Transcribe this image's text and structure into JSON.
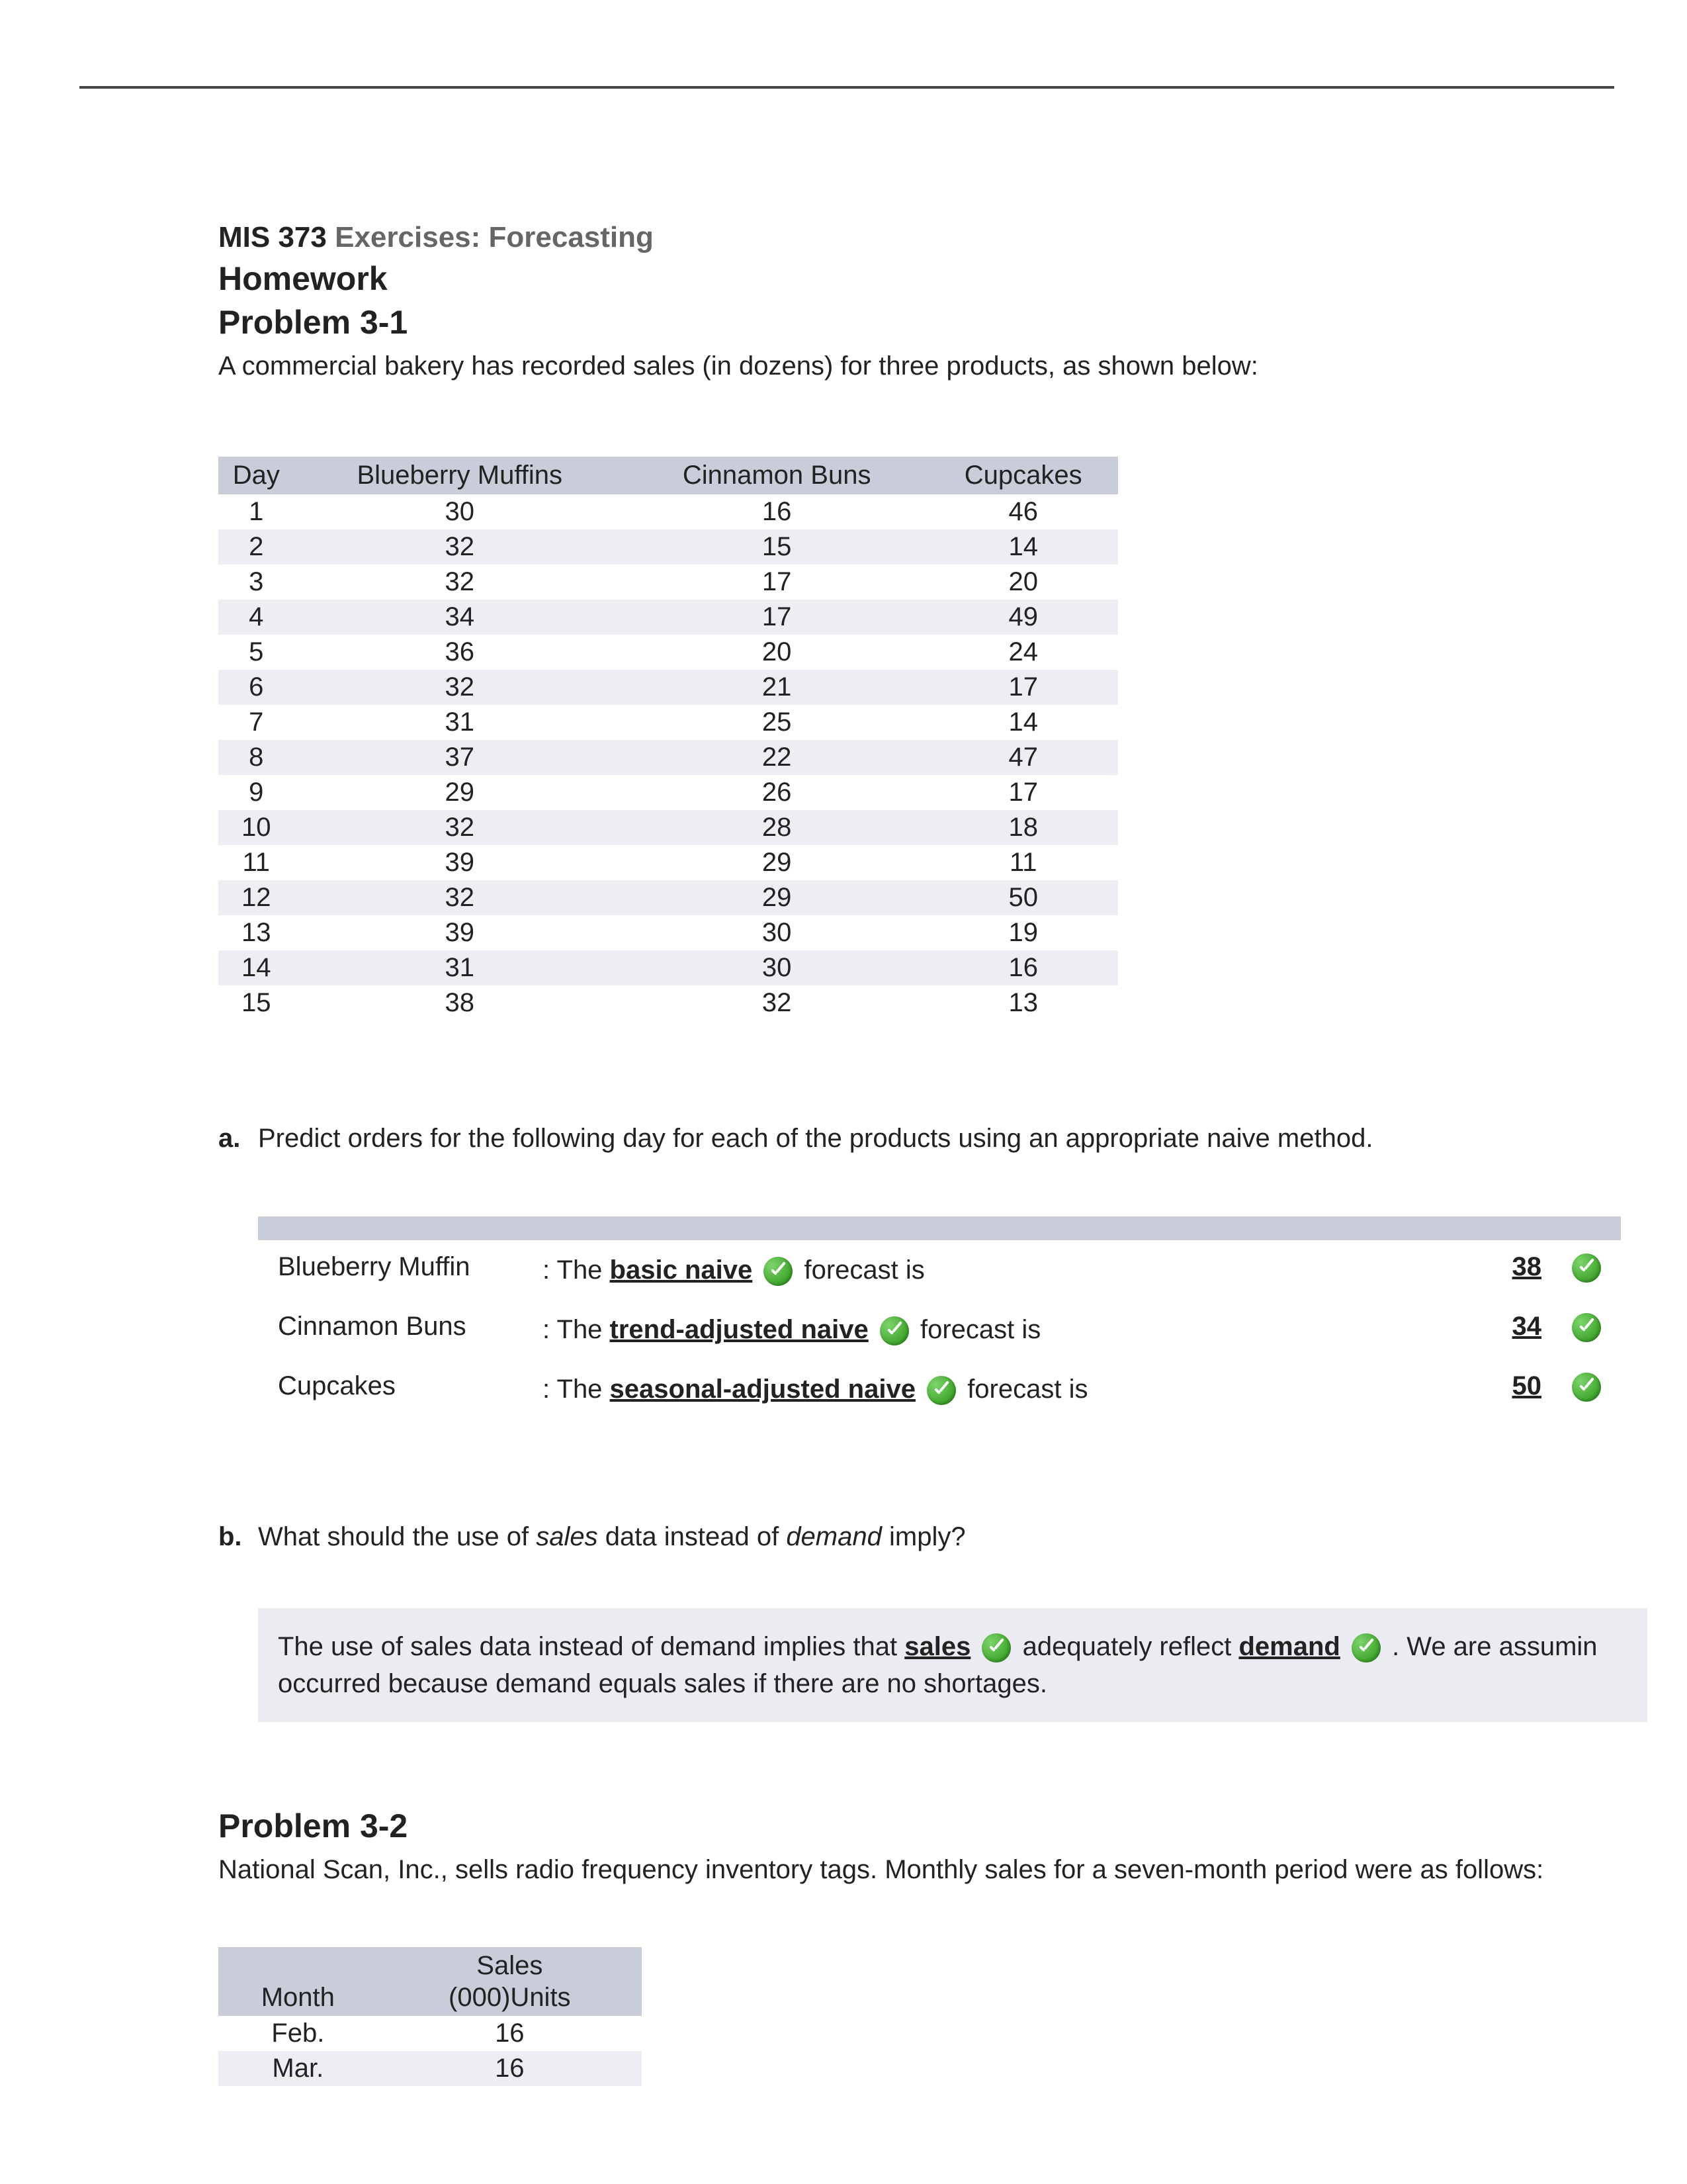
{
  "course": {
    "code": "MIS 373",
    "subtitle": "Exercises: Forecasting"
  },
  "hw_label": "Homework",
  "p1": {
    "title": "Problem 3-1",
    "intro": "A commercial bakery has recorded sales (in dozens) for three products, as shown below:",
    "table": {
      "headers": [
        "Day",
        "Blueberry Muffins",
        "Cinnamon Buns",
        "Cupcakes"
      ],
      "rows": [
        [
          "1",
          "30",
          "16",
          "46"
        ],
        [
          "2",
          "32",
          "15",
          "14"
        ],
        [
          "3",
          "32",
          "17",
          "20"
        ],
        [
          "4",
          "34",
          "17",
          "49"
        ],
        [
          "5",
          "36",
          "20",
          "24"
        ],
        [
          "6",
          "32",
          "21",
          "17"
        ],
        [
          "7",
          "31",
          "25",
          "14"
        ],
        [
          "8",
          "37",
          "22",
          "47"
        ],
        [
          "9",
          "29",
          "26",
          "17"
        ],
        [
          "10",
          "32",
          "28",
          "18"
        ],
        [
          "11",
          "39",
          "29",
          "11"
        ],
        [
          "12",
          "32",
          "29",
          "50"
        ],
        [
          "13",
          "39",
          "30",
          "19"
        ],
        [
          "14",
          "31",
          "30",
          "16"
        ],
        [
          "15",
          "38",
          "32",
          "13"
        ]
      ]
    },
    "a": {
      "label": "a.",
      "q": "Predict orders for the following day for each of the products using an appropriate naive method.",
      "rows": [
        {
          "product": "Blueberry Muffin",
          "prefix": ": The ",
          "method": "basic naive",
          "tail": " forecast is",
          "value": "38"
        },
        {
          "product": "Cinnamon Buns",
          "prefix": ": The ",
          "method": "trend-adjusted naive",
          "tail": " forecast is",
          "value": "34"
        },
        {
          "product": "Cupcakes",
          "prefix": ": The ",
          "method": "seasonal-adjusted naive",
          "tail": " forecast is",
          "value": "50"
        }
      ]
    },
    "b": {
      "label": "b.",
      "q_pre": "What should the use of ",
      "q_em1": "sales",
      "q_mid": " data instead of ",
      "q_em2": "demand",
      "q_post": " imply?",
      "ans_pre": "The use of sales data instead of demand implies that ",
      "ans_w1": "sales",
      "ans_mid": " adequately reflect ",
      "ans_w2": "demand",
      "ans_post1": " . We are assumin",
      "ans_line2": "occurred because demand equals sales if there are no shortages."
    }
  },
  "p2": {
    "title": "Problem 3-2",
    "intro": "National Scan, Inc., sells radio frequency inventory tags. Monthly sales for a seven-month period were as follows:",
    "table": {
      "h1": "Month",
      "h2a": "Sales",
      "h2b": "(000)Units",
      "rows": [
        [
          "Feb.",
          "16"
        ],
        [
          "Mar.",
          "16"
        ]
      ]
    }
  }
}
